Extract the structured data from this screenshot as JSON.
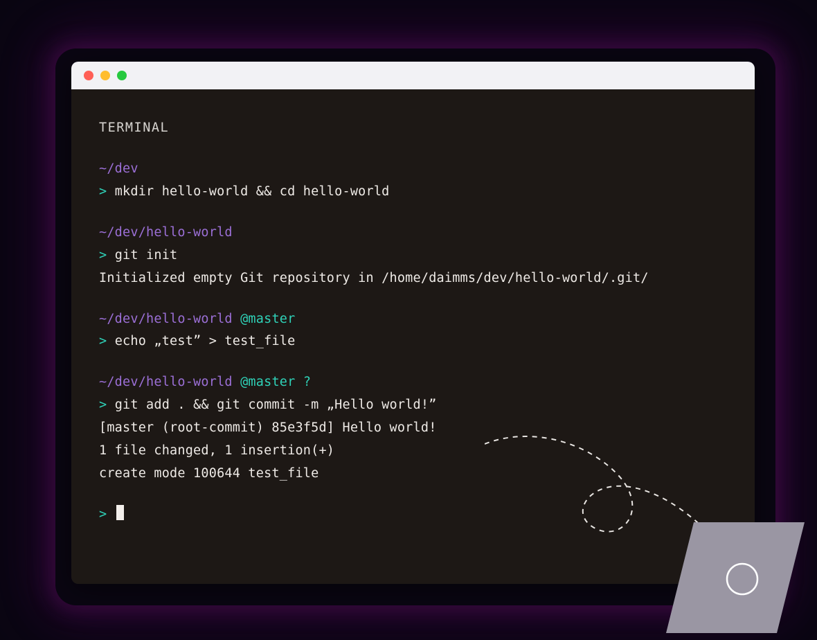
{
  "colors": {
    "background": "#0a0612",
    "terminal_bg": "#1d1815",
    "titlebar": "#f2f2f5",
    "close": "#ff5f56",
    "minimize": "#ffbd2e",
    "maximize": "#27c93f",
    "path": "#9b6fd6",
    "branch": "#2fd2b8",
    "prompt": "#2fd2b8",
    "text": "#e9e6e3"
  },
  "terminal": {
    "title": "TERMINAL",
    "blocks": [
      {
        "path": "~/dev",
        "branch": "",
        "status": "",
        "prompt": ">",
        "command": "mkdir hello-world && cd hello-world",
        "output": []
      },
      {
        "path": "~/dev/hello-world",
        "branch": "",
        "status": "",
        "prompt": ">",
        "command": "git init",
        "output": [
          "Initialized empty Git repository in /home/daimms/dev/hello-world/.git/"
        ]
      },
      {
        "path": "~/dev/hello-world",
        "branch": "@master",
        "status": "",
        "prompt": ">",
        "command": "echo „test” > test_file",
        "output": []
      },
      {
        "path": "~/dev/hello-world",
        "branch": "@master",
        "status": "?",
        "prompt": ">",
        "command": "git add . && git commit -m „Hello world!”",
        "output": [
          "[master (root-commit) 85e3f5d] Hello world!",
          "1 file changed, 1 insertion(+)",
          "create mode 100644 test_file"
        ]
      }
    ],
    "active_prompt": ">"
  }
}
